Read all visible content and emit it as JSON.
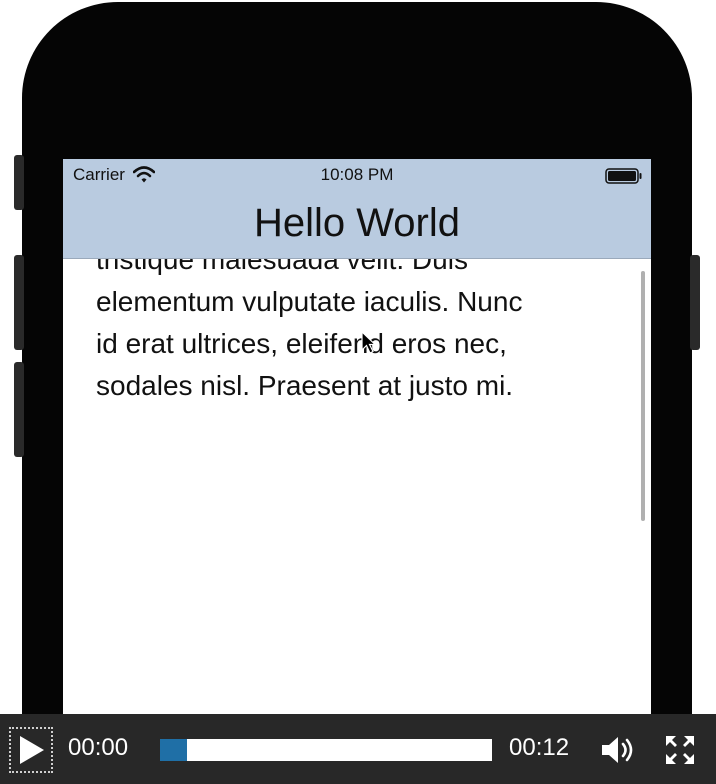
{
  "status_bar": {
    "carrier": "Carrier",
    "time": "10:08 PM"
  },
  "nav": {
    "title": "Hello World"
  },
  "content": {
    "lines": [
      "tristique malesuada velit. Duis",
      "elementum vulputate iaculis. Nunc",
      "id erat ultrices, eleifend eros nec,",
      "sodales nisl. Praesent at justo mi."
    ]
  },
  "video_controls": {
    "current_time": "00:00",
    "total_time": "00:12",
    "progress_fraction": 0.08
  },
  "colors": {
    "nav_background": "#b9cbe0",
    "progress_fill": "#1f6fa6",
    "controls_background": "#282828"
  },
  "icons": [
    "wifi-icon",
    "battery-icon",
    "play-icon",
    "volume-icon",
    "fullscreen-icon",
    "cursor-icon"
  ]
}
